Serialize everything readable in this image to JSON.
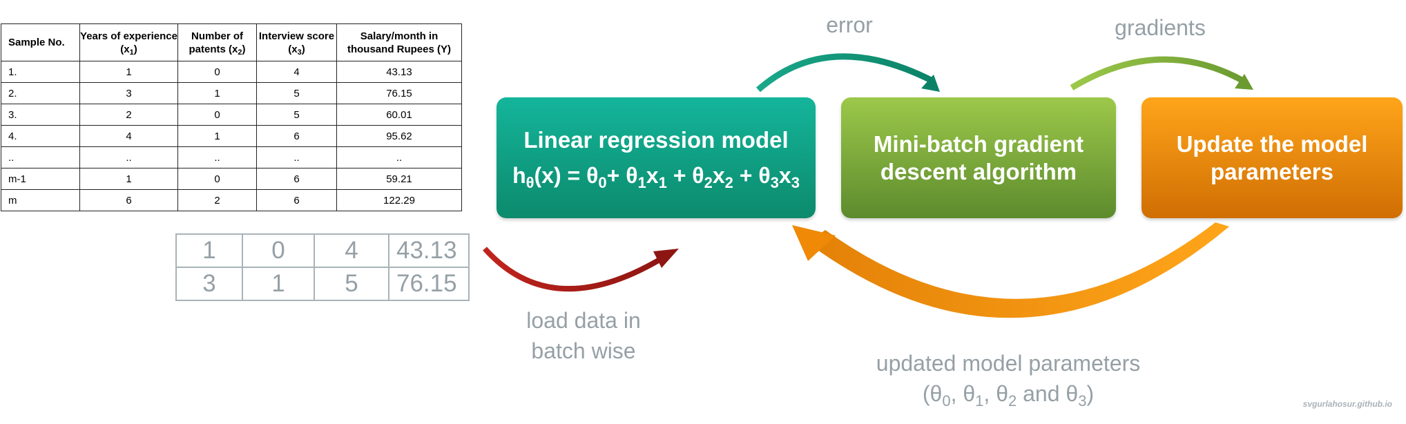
{
  "table": {
    "headers": [
      {
        "text": "Sample No.",
        "sub": ""
      },
      {
        "text": "Years of experience (x",
        "sub": "1",
        "tail": ")"
      },
      {
        "text": "Number of patents (x",
        "sub": "2",
        "tail": ")"
      },
      {
        "text": "Interview score (x",
        "sub": "3",
        "tail": ")"
      },
      {
        "text": "Salary/month in thousand Rupees (Y)",
        "sub": ""
      }
    ],
    "rows": [
      [
        "1.",
        "1",
        "0",
        "4",
        "43.13"
      ],
      [
        "2.",
        "3",
        "1",
        "5",
        "76.15"
      ],
      [
        "3.",
        "2",
        "0",
        "5",
        "60.01"
      ],
      [
        "4.",
        "4",
        "1",
        "6",
        "95.62"
      ],
      [
        "..",
        "..",
        "..",
        "..",
        ".."
      ],
      [
        "m-1",
        "1",
        "0",
        "6",
        "59.21"
      ],
      [
        "m",
        "6",
        "2",
        "6",
        "122.29"
      ]
    ]
  },
  "batch": {
    "rows": [
      [
        "1",
        "0",
        "4",
        "43.13"
      ],
      [
        "3",
        "1",
        "5",
        "76.15"
      ]
    ]
  },
  "boxes": {
    "model": {
      "title": "Linear regression model",
      "formula_parts": [
        "h",
        "θ",
        "(x) = θ",
        "0",
        "+ θ",
        "1",
        "x",
        "1",
        " + θ",
        "2",
        "x",
        "2",
        " + θ",
        "3",
        "x",
        "3"
      ]
    },
    "gd": {
      "line1": "Mini-batch gradient",
      "line2": "descent algorithm"
    },
    "update": {
      "line1": "Update the model",
      "line2": "parameters"
    }
  },
  "labels": {
    "error": "error",
    "gradients": "gradients",
    "load_line1": "load data in",
    "load_line2": "batch wise",
    "updated_line1": "updated model parameters",
    "updated_line2_parts": [
      "(θ",
      "0",
      ", θ",
      "1",
      ", θ",
      "2",
      " and θ",
      "3",
      ")"
    ],
    "watermark": "svgurlahosur.github.io"
  },
  "colors": {
    "teal": "#0f9e80",
    "green": "#7aab3a",
    "orange": "#f08a0a",
    "red": "#c0241c",
    "label_gray": "#95a0a6"
  }
}
